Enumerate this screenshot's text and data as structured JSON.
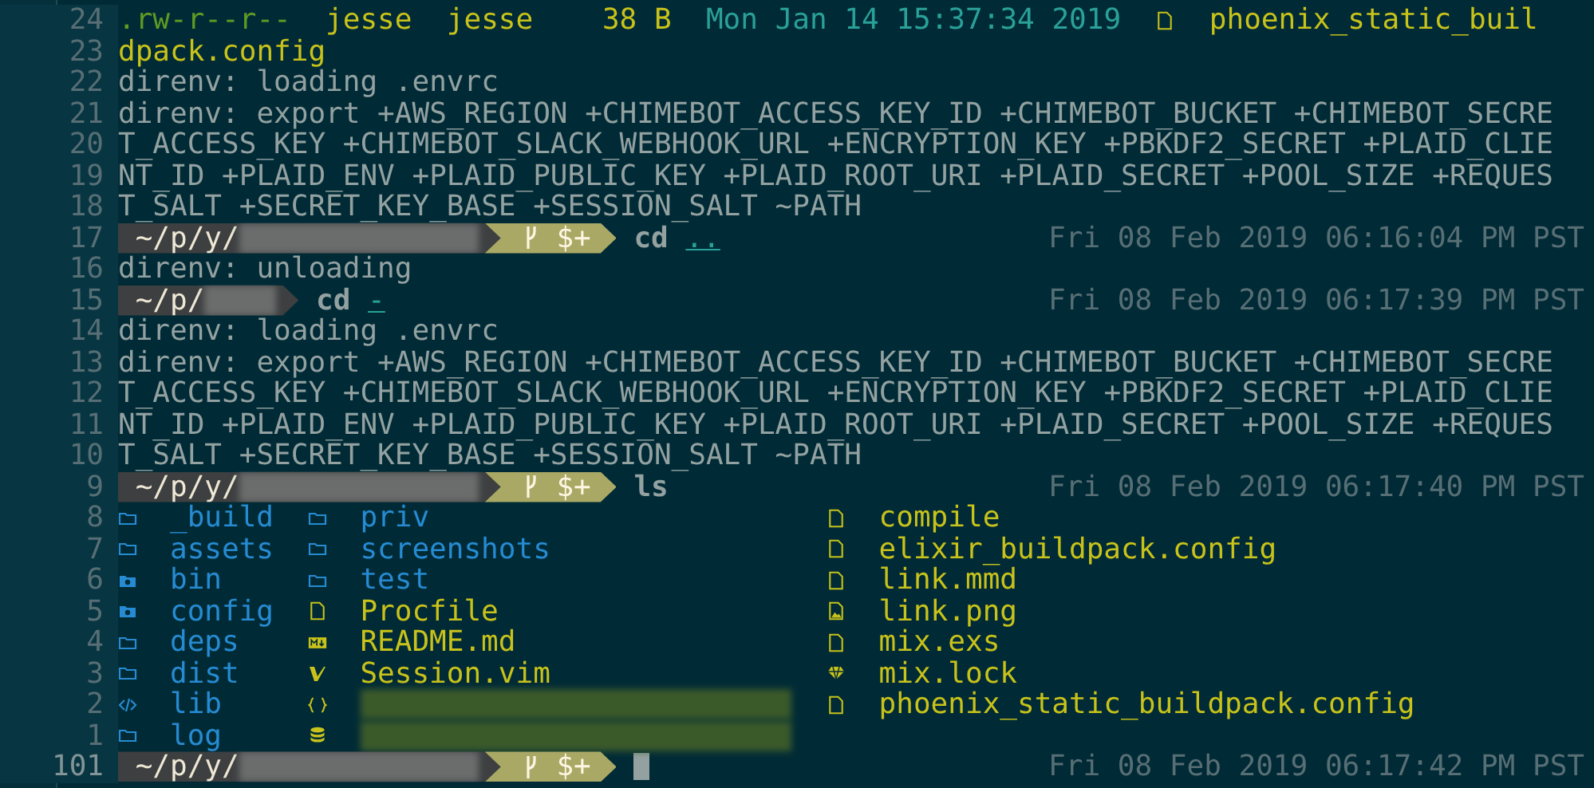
{
  "lines": [
    {
      "number": "24",
      "kind": "long_listing",
      "perms": ".rw-r--r--",
      "user": "jesse",
      "group": "jesse",
      "size": "38 B",
      "date": "Mon Jan 14 15:37:34 2019",
      "name": "phoenix_static_buil"
    },
    {
      "number": "23",
      "kind": "filename",
      "text": "dpack.config"
    },
    {
      "number": "22",
      "kind": "output",
      "text": "direnv: loading .envrc"
    },
    {
      "number": "21",
      "kind": "output",
      "text": "direnv: export +AWS_REGION +CHIMEBOT_ACCESS_KEY_ID +CHIMEBOT_BUCKET +CHIMEBOT_SECRE"
    },
    {
      "number": "20",
      "kind": "output",
      "text": "T_ACCESS_KEY +CHIMEBOT_SLACK_WEBHOOK_URL +ENCRYPTION_KEY +PBKDF2_SECRET +PLAID_CLIE"
    },
    {
      "number": "19",
      "kind": "output",
      "text": "NT_ID +PLAID_ENV +PLAID_PUBLIC_KEY +PLAID_ROOT_URI +PLAID_SECRET +POOL_SIZE +REQUES"
    },
    {
      "number": "18",
      "kind": "output",
      "text": "T_SALT +SECRET_KEY_BASE +SESSION_SALT ~PATH"
    },
    {
      "number": "17",
      "kind": "prompt",
      "path": "~/p/y/",
      "git": true,
      "git_status": "$+",
      "command": "cd",
      "argument": "..",
      "time": "Fri 08 Feb 2019 06:16:04 PM PST"
    },
    {
      "number": "16",
      "kind": "output",
      "text": "direnv: unloading"
    },
    {
      "number": "15",
      "kind": "prompt",
      "path": "~/p/",
      "git": false,
      "command": "cd",
      "argument": "-",
      "time": "Fri 08 Feb 2019 06:17:39 PM PST"
    },
    {
      "number": "14",
      "kind": "output",
      "text": "direnv: loading .envrc"
    },
    {
      "number": "13",
      "kind": "output",
      "text": "direnv: export +AWS_REGION +CHIMEBOT_ACCESS_KEY_ID +CHIMEBOT_BUCKET +CHIMEBOT_SECRE"
    },
    {
      "number": "12",
      "kind": "output",
      "text": "T_ACCESS_KEY +CHIMEBOT_SLACK_WEBHOOK_URL +ENCRYPTION_KEY +PBKDF2_SECRET +PLAID_CLIE"
    },
    {
      "number": "11",
      "kind": "output",
      "text": "NT_ID +PLAID_ENV +PLAID_PUBLIC_KEY +PLAID_ROOT_URI +PLAID_SECRET +POOL_SIZE +REQUES"
    },
    {
      "number": "10",
      "kind": "output",
      "text": "T_SALT +SECRET_KEY_BASE +SESSION_SALT ~PATH"
    },
    {
      "number": "9",
      "kind": "prompt",
      "path": "~/p/y/",
      "git": true,
      "git_status": "$+",
      "command": "ls",
      "time": "Fri 08 Feb 2019 06:17:40 PM PST"
    },
    {
      "number": "8",
      "kind": "ls",
      "entries": [
        {
          "kind": "folder",
          "name": "_build"
        },
        {
          "kind": "folder",
          "name": "priv"
        },
        {
          "kind": "file",
          "name": "compile"
        }
      ]
    },
    {
      "number": "7",
      "kind": "ls",
      "entries": [
        {
          "kind": "folder",
          "name": "assets"
        },
        {
          "kind": "folder",
          "name": "screenshots"
        },
        {
          "kind": "file",
          "name": "elixir_buildpack.config"
        }
      ]
    },
    {
      "number": "6",
      "kind": "ls",
      "entries": [
        {
          "kind": "config",
          "name": "bin"
        },
        {
          "kind": "folder",
          "name": "test"
        },
        {
          "kind": "file",
          "name": "link.mmd"
        }
      ]
    },
    {
      "number": "5",
      "kind": "ls",
      "entries": [
        {
          "kind": "config",
          "name": "config"
        },
        {
          "kind": "file",
          "name": "Procfile"
        },
        {
          "kind": "image",
          "name": "link.png"
        }
      ]
    },
    {
      "number": "4",
      "kind": "ls",
      "entries": [
        {
          "kind": "folder",
          "name": "deps"
        },
        {
          "kind": "markdown",
          "name": "README.md"
        },
        {
          "kind": "file",
          "name": "mix.exs"
        }
      ]
    },
    {
      "number": "3",
      "kind": "ls",
      "entries": [
        {
          "kind": "folder",
          "name": "dist"
        },
        {
          "kind": "vim",
          "name": "Session.vim"
        },
        {
          "kind": "gem",
          "name": "mix.lock"
        }
      ]
    },
    {
      "number": "2",
      "kind": "ls",
      "entries": [
        {
          "kind": "code",
          "name": "lib"
        },
        {
          "kind": "json"
        },
        {
          "kind": "file",
          "name": "phoenix_static_buildpack.config"
        }
      ]
    },
    {
      "number": "1",
      "kind": "ls",
      "entries": [
        {
          "kind": "folder",
          "name": "log"
        },
        {
          "kind": "database"
        }
      ]
    },
    {
      "number": "101",
      "kind": "prompt",
      "path": "~/p/y/",
      "git": true,
      "git_status": "$+",
      "cursor": true,
      "time": "Fri 08 Feb 2019 06:17:42 PM PST"
    }
  ]
}
